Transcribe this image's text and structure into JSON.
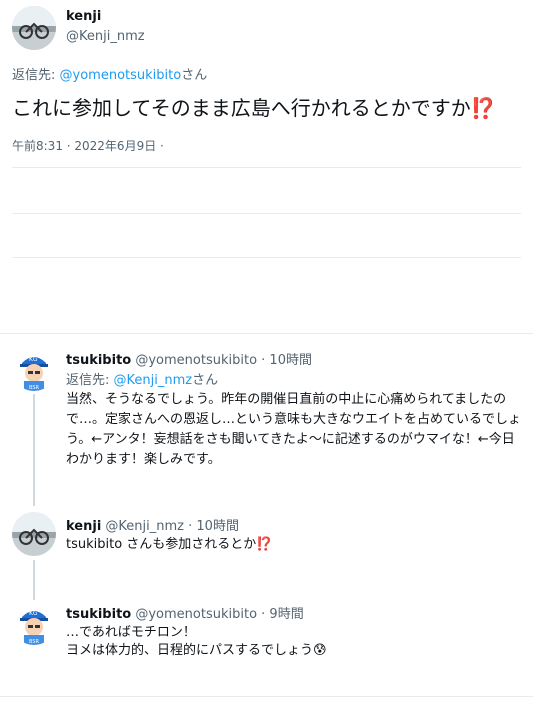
{
  "main_tweet": {
    "author_name": "kenji",
    "author_handle": "@Kenji_nmz",
    "reply_prefix": "返信先: ",
    "reply_to": "@yomenotsukibito",
    "reply_suffix": "さん",
    "text": "これに参加してそのまま広島へ行かれるとかですか",
    "emoji": "⁉️",
    "timestamp": "午前8:31 · 2022年6月9日 ·"
  },
  "replies": [
    {
      "author_name": "tsukibito",
      "author_handle": "@yomenotsukibito",
      "time": " · 10時間",
      "reply_prefix": "返信先: ",
      "reply_to": "@Kenji_nmz",
      "reply_suffix": "さん",
      "text": "当然、そうなるでしょう。昨年の開催日直前の中止に心痛められてましたので…。定家さんへの恩返し…という意味も大きなウエイトを占めているでしょう。←アンタ！妄想話をさも聞いてきたよ〜に記述するのがウマイな！←今日わかります！楽しみです。"
    },
    {
      "author_name": "kenji",
      "author_handle": "@Kenji_nmz",
      "time": " · 10時間",
      "text": "tsukibito さんも参加されるとか",
      "emoji": "⁉️"
    },
    {
      "author_name": "tsukibito",
      "author_handle": "@yomenotsukibito",
      "time": " · 9時間",
      "line1": "…であればモチロン！",
      "line2": "ヨメは体力的、日程的にパスするでしょう",
      "emoji": "😰"
    }
  ],
  "colors": {
    "link": "#1d9bf0",
    "muted": "#536471",
    "divider": "#e6ecf0",
    "accent_bang": "#d0152b"
  }
}
